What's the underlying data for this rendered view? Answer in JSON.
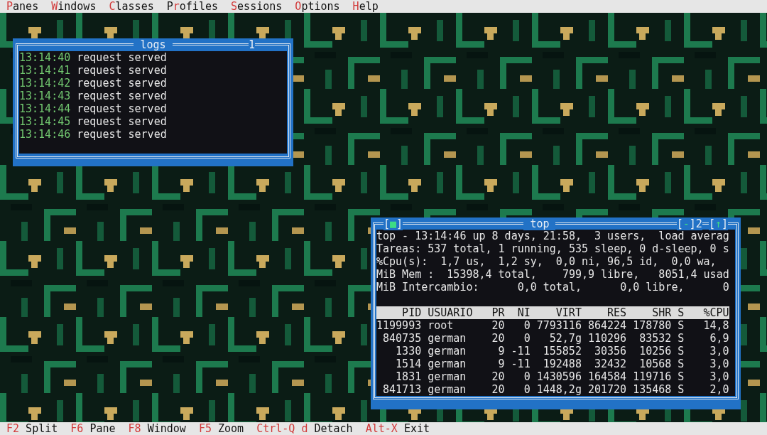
{
  "menu_bar": [
    {
      "hotkey": "P",
      "rest": "anes"
    },
    {
      "hotkey": "W",
      "rest": "indows"
    },
    {
      "hotkey": "C",
      "rest": "lasses"
    },
    {
      "start": "P",
      "hotkey": "r",
      "rest": "ofiles"
    },
    {
      "hotkey": "S",
      "rest": "essions"
    },
    {
      "hotkey": "O",
      "rest": "ptions"
    },
    {
      "hotkey": "H",
      "rest": "elp"
    }
  ],
  "windows": [
    {
      "kind": "log",
      "title": "logs",
      "number": "1",
      "lines": [
        {
          "time": "13:14:40",
          "message": "request served"
        },
        {
          "time": "13:14:41",
          "message": "request served"
        },
        {
          "time": "13:14:42",
          "message": "request served"
        },
        {
          "time": "13:14:43",
          "message": "request served"
        },
        {
          "time": "13:14:44",
          "message": "request served"
        },
        {
          "time": "13:14:45",
          "message": "request served"
        },
        {
          "time": "13:14:46",
          "message": "request served"
        }
      ]
    },
    {
      "kind": "top",
      "title": "top",
      "number": "2",
      "left_buttons": [
        {
          "open": "[",
          "glyph": "■",
          "close": "]"
        }
      ],
      "right_buttons": [
        {
          "open": "[",
          "glyph": "-",
          "close": "]"
        },
        {
          "open": "[",
          "glyph": "↑",
          "close": "]"
        }
      ],
      "summary": [
        "top - 13:14:46 up 8 days, 21:58,  3 users,  load averag",
        "Tareas: 537 total, 1 running, 535 sleep, 0 d-sleep, 0 s",
        "%Cpu(s):  1,7 us,  1,2 sy,  0,0 ni, 96,5 id,  0,0 wa,",
        "MiB Mem :  15398,4 total,    799,9 libre,   8051,4 usad",
        "MiB Intercambio:      0,0 total,      0,0 libre,      0"
      ],
      "table": {
        "columns": [
          "PID",
          "USUARIO",
          "PR",
          "NI",
          "VIRT",
          "RES",
          "SHR",
          "S",
          "%CPU"
        ],
        "rows": [
          [
            "1199993",
            "root",
            "20",
            "0",
            "7793116",
            "864224",
            "178780",
            "S",
            "14,8"
          ],
          [
            "840735",
            "german",
            "20",
            "0",
            "52,7g",
            "110296",
            "83532",
            "S",
            "6,9"
          ],
          [
            "1330",
            "german",
            "9",
            "-11",
            "155852",
            "30356",
            "10256",
            "S",
            "3,0"
          ],
          [
            "1514",
            "german",
            "9",
            "-11",
            "192488",
            "32432",
            "10568",
            "S",
            "3,0"
          ],
          [
            "1831",
            "german",
            "20",
            "0",
            "1430596",
            "164584",
            "119716",
            "S",
            "3,0"
          ],
          [
            "841713",
            "german",
            "20",
            "0",
            "1448,2g",
            "201720",
            "135468",
            "S",
            "2,0"
          ]
        ]
      }
    }
  ],
  "status_bar": [
    {
      "key": "F2",
      "label": "Split"
    },
    {
      "key": "F6",
      "label": "Pane"
    },
    {
      "key": "F8",
      "label": "Window"
    },
    {
      "key": "F5",
      "label": "Zoom"
    },
    {
      "key": "Ctrl-Q d",
      "label": "Detach"
    },
    {
      "key": "Alt-X",
      "label": "Exit"
    }
  ]
}
